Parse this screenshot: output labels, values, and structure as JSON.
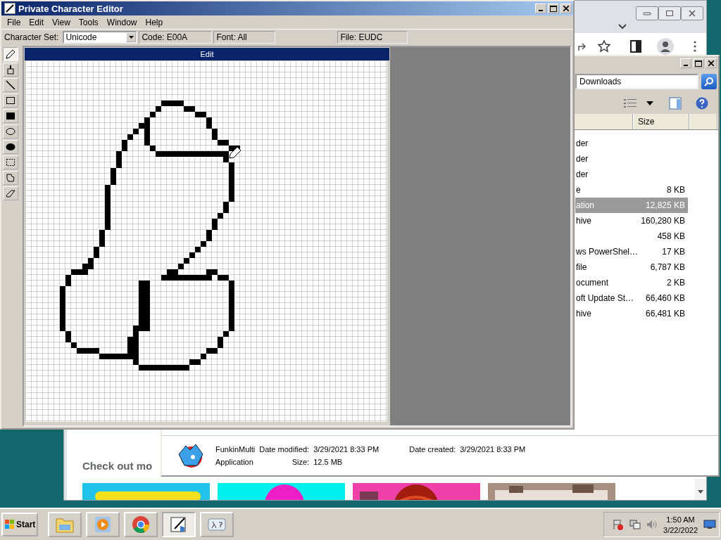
{
  "pce": {
    "title": "Private Character Editor",
    "menu": [
      "File",
      "Edit",
      "View",
      "Tools",
      "Window",
      "Help"
    ],
    "charset_label": "Character Set:",
    "charset": "Unicode",
    "fields": [
      "Code: E00A",
      "Font: All",
      "File: EUDC"
    ],
    "tools": [
      {
        "kind": "pencil",
        "selected": true
      },
      {
        "kind": "brush",
        "selected": false
      },
      {
        "kind": "line",
        "selected": false
      },
      {
        "kind": "hollow-rect",
        "selected": false
      },
      {
        "kind": "filled-rect",
        "selected": false
      },
      {
        "kind": "hollow-ellipse",
        "selected": false
      },
      {
        "kind": "filled-ellipse",
        "selected": false
      },
      {
        "kind": "rect-select",
        "selected": false
      },
      {
        "kind": "freeform-select",
        "selected": false
      },
      {
        "kind": "eraser",
        "selected": false
      }
    ],
    "edit_title": "Edit"
  },
  "explorer": {
    "address": "Downloads",
    "columns": [
      "Size"
    ],
    "rows": [
      {
        "type": "der",
        "selected": false
      },
      {
        "type": "der",
        "selected": false
      },
      {
        "type": "der",
        "selected": false
      },
      {
        "type": "e",
        "size": "8 KB",
        "selected": false
      },
      {
        "type": "ation",
        "size": "12,825 KB",
        "selected": true
      },
      {
        "type": "hive",
        "size": "160,280 KB",
        "selected": false
      },
      {
        "size": "458 KB",
        "selected": false
      },
      {
        "type": "ws PowerShel…",
        "size": "17 KB",
        "selected": false
      },
      {
        "type": "file",
        "size": "6,787 KB",
        "selected": false
      },
      {
        "type": "ocument",
        "size": "2 KB",
        "selected": false
      },
      {
        "type": "oft Update St…",
        "size": "66,460 KB",
        "selected": false
      },
      {
        "type": "hive",
        "size": "66,481 KB",
        "selected": false
      }
    ],
    "details": {
      "name": "FunkinMulti",
      "type": "Application",
      "modified_label": "Date modified:",
      "modified": "3/29/2021 8:33 PM",
      "created_label": "Date created:",
      "created": "3/29/2021 8:33 PM",
      "size_label": "Size:",
      "size": "12.5 MB"
    }
  },
  "browser": {
    "heading": "Check out mo"
  },
  "taskbar": {
    "start": "Start",
    "tasks": [
      {
        "kind": "explorer",
        "selected": false
      },
      {
        "kind": "media-player",
        "selected": false
      },
      {
        "kind": "chrome",
        "selected": false
      },
      {
        "kind": "character-editor",
        "selected": true
      },
      {
        "kind": "ime",
        "selected": false
      }
    ],
    "time": "1:50 AM",
    "date": "3/22/2022"
  }
}
